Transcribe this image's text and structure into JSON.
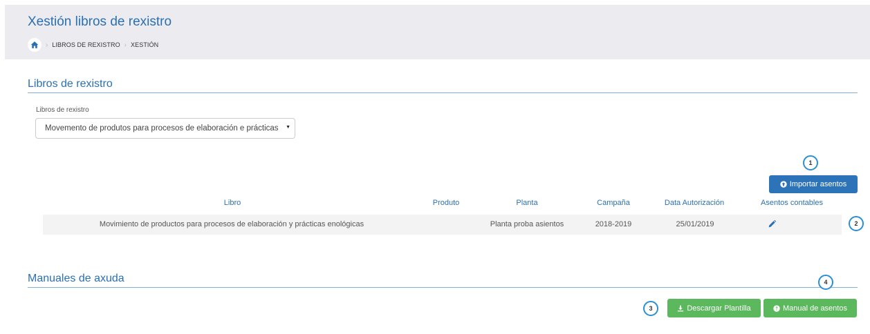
{
  "header": {
    "title": "Xestión libros de rexistro",
    "breadcrumb": [
      "LIBROS DE REXISTRO",
      "XESTIÓN"
    ]
  },
  "registros": {
    "section_title": "Libros de rexistro",
    "select_label": "Libros de rexistro",
    "select_value": "Movemento de produtos para procesos de elaboración e prácticas enolóxicas",
    "import_button": "Importar asentos",
    "table": {
      "columns": [
        "Libro",
        "Produto",
        "Planta",
        "Campaña",
        "Data Autorización",
        "Asentos contables"
      ],
      "rows": [
        {
          "libro": "Movimiento de productos para procesos de elaboración y prácticas enológicas",
          "produto": "",
          "planta": "Planta proba asientos",
          "campana": "2018-2019",
          "data": "25/01/2019",
          "asentos_icon": "pencil-icon"
        }
      ]
    }
  },
  "manuais": {
    "section_title": "Manuales de axuda",
    "download_button": "Descargar Plantilla",
    "manual_button": "Manual de asentos"
  },
  "callouts": [
    "1",
    "2",
    "3",
    "4"
  ],
  "colors": {
    "accent": "#2a6fb3",
    "primary_button": "#2d73b8",
    "success_button": "#5cb85c",
    "header_bg": "#ececf0",
    "callout_ring": "#2a8fd6"
  }
}
